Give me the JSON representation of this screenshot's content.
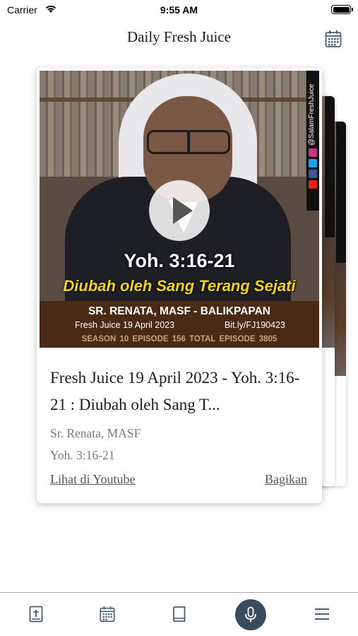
{
  "status_bar": {
    "carrier": "Carrier",
    "time": "9:55 AM"
  },
  "nav": {
    "title": "Daily Fresh Juice",
    "calendar_icon": "calendar-icon"
  },
  "card": {
    "thumbnail": {
      "handle": "@SalamFreshJuice",
      "verse": "Yoh. 3:16-21",
      "subtitle": "Diubah oleh Sang Terang Sejati",
      "name": "SR. RENATA, MASF - BALIKPAPAN",
      "date": "Fresh Juice 19 April 2023",
      "link": "Bit.ly/FJ190423",
      "meta": "SEASON 10    EPISODE 156    TOTAL EPISODE 3805"
    },
    "title": "Fresh Juice 19 April 2023 - Yoh. 3:16-21  :  Diubah oleh Sang T...",
    "speaker": "Sr. Renata, MASF",
    "reference": "Yoh. 3:16-21",
    "youtube_label": "Lihat di Youtube",
    "share_label": "Bagikan"
  },
  "tabs": [
    {
      "name": "bible",
      "icon": "bible-icon"
    },
    {
      "name": "calendar",
      "icon": "calendar-icon"
    },
    {
      "name": "book",
      "icon": "book-icon"
    },
    {
      "name": "record",
      "icon": "microphone-icon"
    },
    {
      "name": "menu",
      "icon": "menu-icon"
    }
  ],
  "colors": {
    "accent_record": "#3a4b5e",
    "subtitle_yellow": "#f5d60d",
    "band_brown": "#4a2a14"
  }
}
